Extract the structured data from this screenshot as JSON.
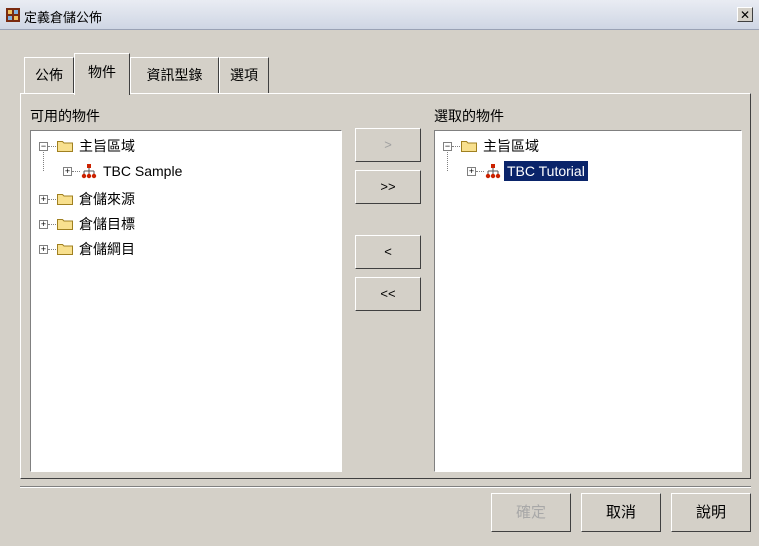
{
  "window": {
    "title": "定義倉儲公佈",
    "close_glyph": "✕"
  },
  "tabs": [
    {
      "label": "公佈",
      "active": false
    },
    {
      "label": "物件",
      "active": true
    },
    {
      "label": "資訊型錄",
      "active": false
    },
    {
      "label": "選項",
      "active": false
    }
  ],
  "available": {
    "label": "可用的物件",
    "tree": [
      {
        "label": "主旨區域",
        "icon": "folder-icon",
        "expanded": true
      },
      {
        "label": "TBC Sample",
        "icon": "hierarchy-icon",
        "expanded": false
      },
      {
        "label": "倉儲來源",
        "icon": "folder-icon",
        "expanded": false
      },
      {
        "label": "倉儲目標",
        "icon": "folder-icon",
        "expanded": false
      },
      {
        "label": "倉儲綱目",
        "icon": "folder-icon",
        "expanded": false
      }
    ]
  },
  "selected": {
    "label": "選取的物件",
    "tree": [
      {
        "label": "主旨區域",
        "icon": "folder-icon",
        "expanded": true
      },
      {
        "label": "TBC Tutorial",
        "icon": "hierarchy-icon",
        "expanded": false,
        "selected": true
      }
    ]
  },
  "move_buttons": {
    "add": ">",
    "add_all": ">>",
    "remove": "<",
    "remove_all": "<<"
  },
  "dialog_buttons": {
    "ok": "確定",
    "cancel": "取消",
    "help": "說明"
  },
  "colors": {
    "selection": "#0a246a",
    "folder": "#f8e08e",
    "hierarchy": "#cc2200"
  }
}
